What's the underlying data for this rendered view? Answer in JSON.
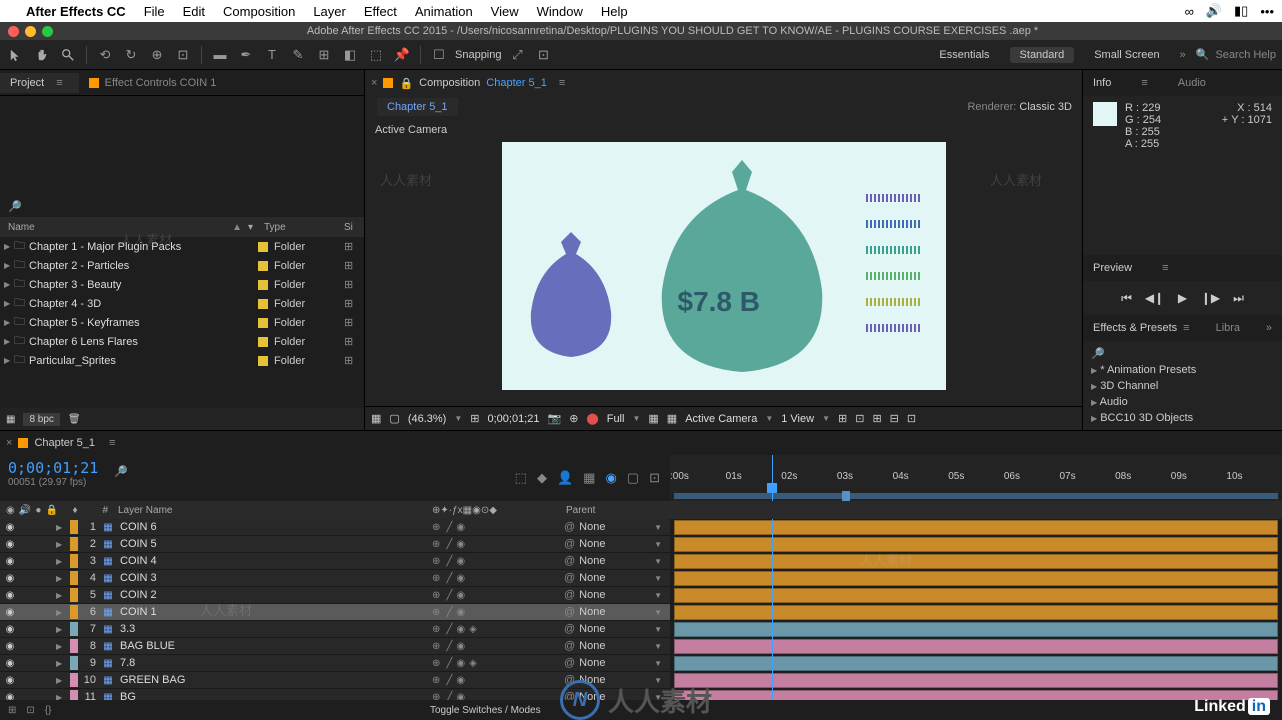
{
  "menubar": {
    "app": "After Effects CC",
    "items": [
      "File",
      "Edit",
      "Composition",
      "Layer",
      "Effect",
      "Animation",
      "View",
      "Window",
      "Help"
    ]
  },
  "titlebar": "Adobe After Effects CC 2015 - /Users/nicosannretina/Desktop/PLUGINS YOU SHOULD GET  TO KNOW/AE - PLUGINS COURSE EXERCISES .aep *",
  "toolbar": {
    "snapping": "Snapping",
    "workspaces": [
      "Essentials",
      "Standard",
      "Small Screen"
    ],
    "ws_active": 1,
    "search_placeholder": "Search Help"
  },
  "project": {
    "tab1": "Project",
    "tab2": "Effect Controls COIN 1",
    "columns": {
      "name": "Name",
      "type": "Type",
      "size": "Si"
    },
    "items": [
      {
        "name": "Chapter 1 - Major Plugin Packs",
        "type": "Folder"
      },
      {
        "name": "Chapter 2 - Particles",
        "type": "Folder"
      },
      {
        "name": "Chapter 3 - Beauty",
        "type": "Folder"
      },
      {
        "name": "Chapter 4 - 3D",
        "type": "Folder"
      },
      {
        "name": "Chapter 5 - Keyframes",
        "type": "Folder"
      },
      {
        "name": "Chapter 6 Lens Flares",
        "type": "Folder"
      },
      {
        "name": "Particular_Sprites",
        "type": "Folder"
      }
    ],
    "footer_bpc": "8 bpc"
  },
  "composition": {
    "label": "Composition",
    "link": "Chapter 5_1",
    "subtab": "Chapter 5_1",
    "renderer_label": "Renderer:",
    "renderer_value": "Classic 3D",
    "camera": "Active Camera",
    "bag_text": "$7.8 B",
    "footer": {
      "zoom": "(46.3%)",
      "timecode": "0;00;01;21",
      "res": "Full",
      "view": "Active Camera",
      "nview": "1 View"
    },
    "bar_colors": [
      "#6a5fb0",
      "#3a6fb0",
      "#3aa090",
      "#5fb070",
      "#a8b040",
      "#6a5fb0"
    ]
  },
  "info": {
    "tab": "Info",
    "tab2": "Audio",
    "r": "229",
    "g": "254",
    "b": "255",
    "a": "255",
    "x": "514",
    "y": "1071"
  },
  "preview": {
    "tab": "Preview"
  },
  "effects": {
    "tab": "Effects & Presets",
    "tab2": "Libra",
    "items": [
      "* Animation Presets",
      "3D Channel",
      "Audio",
      "BCC10 3D Objects"
    ]
  },
  "timeline": {
    "tab": "Chapter 5_1",
    "timecode": "0;00;01;21",
    "frames": "00051 (29.97 fps)",
    "col_num": "#",
    "col_name": "Layer Name",
    "col_parent": "Parent",
    "ruler": [
      ":00s",
      "01s",
      "02s",
      "03s",
      "04s",
      "05s",
      "06s",
      "07s",
      "08s",
      "09s",
      "10s"
    ],
    "layers": [
      {
        "idx": 1,
        "name": "COIN 6",
        "color": "#d99a2b",
        "parent": "None",
        "barColor": "#c98a2a",
        "start": 0
      },
      {
        "idx": 2,
        "name": "COIN 5",
        "color": "#d99a2b",
        "parent": "None",
        "barColor": "#c98a2a",
        "start": 0
      },
      {
        "idx": 3,
        "name": "COIN 4",
        "color": "#d99a2b",
        "parent": "None",
        "barColor": "#c98a2a",
        "start": 0
      },
      {
        "idx": 4,
        "name": "COIN 3",
        "color": "#d99a2b",
        "parent": "None",
        "barColor": "#c98a2a",
        "start": 0
      },
      {
        "idx": 5,
        "name": "COIN 2",
        "color": "#d99a2b",
        "parent": "None",
        "barColor": "#c98a2a",
        "start": 0
      },
      {
        "idx": 6,
        "name": "COIN 1",
        "color": "#d99a2b",
        "parent": "None",
        "barColor": "#c98a2a",
        "start": 0,
        "sel": true
      },
      {
        "idx": 7,
        "name": "3.3",
        "color": "#7aa8b8",
        "parent": "None",
        "barColor": "#6a98a8",
        "start": 0,
        "threed": true
      },
      {
        "idx": 8,
        "name": "BAG BLUE",
        "color": "#d48fb0",
        "parent": "None",
        "barColor": "#c47fa0",
        "start": 0
      },
      {
        "idx": 9,
        "name": "7.8",
        "color": "#7aa8b8",
        "parent": "None",
        "barColor": "#6a98a8",
        "start": 0,
        "threed": true
      },
      {
        "idx": 10,
        "name": "GREEN BAG",
        "color": "#d48fb0",
        "parent": "None",
        "barColor": "#c47fa0",
        "start": 0
      },
      {
        "idx": 11,
        "name": "BG",
        "color": "#d48fb0",
        "parent": "None",
        "barColor": "#c47fa0",
        "start": 0
      }
    ],
    "footer": "Toggle Switches / Modes"
  },
  "branding": {
    "linkedin": "Linked",
    "rsc": "人人素材"
  }
}
